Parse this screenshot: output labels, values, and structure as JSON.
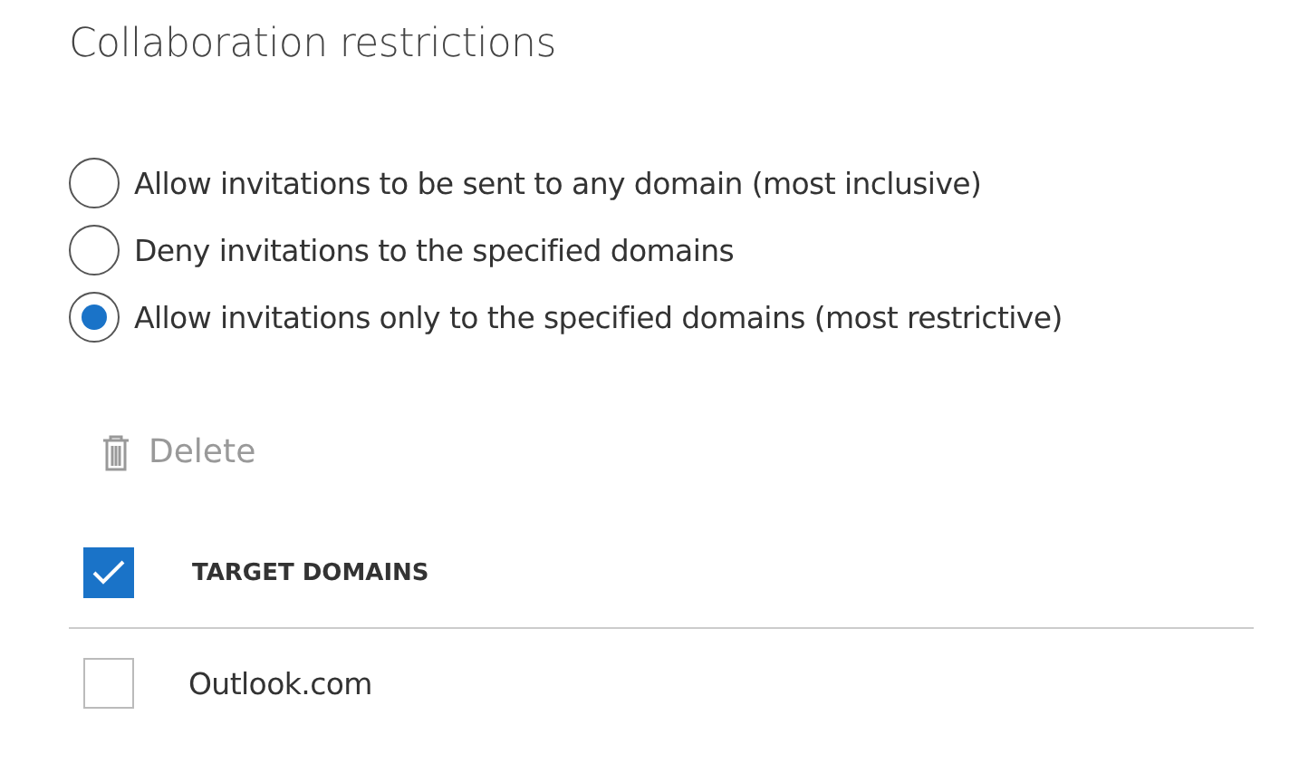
{
  "title": "Collaboration restrictions",
  "options": [
    {
      "label": "Allow invitations to be sent to any domain (most inclusive)",
      "selected": false
    },
    {
      "label": "Deny invitations to the specified domains",
      "selected": false
    },
    {
      "label": "Allow invitations only to the specified domains (most restrictive)",
      "selected": true
    }
  ],
  "toolbar": {
    "delete": {
      "label": "Delete",
      "disabled": true
    }
  },
  "table": {
    "header": {
      "label": "TARGET DOMAINS",
      "checked": true
    },
    "rows": [
      {
        "domain": "Outlook.com",
        "checked": false
      }
    ]
  }
}
